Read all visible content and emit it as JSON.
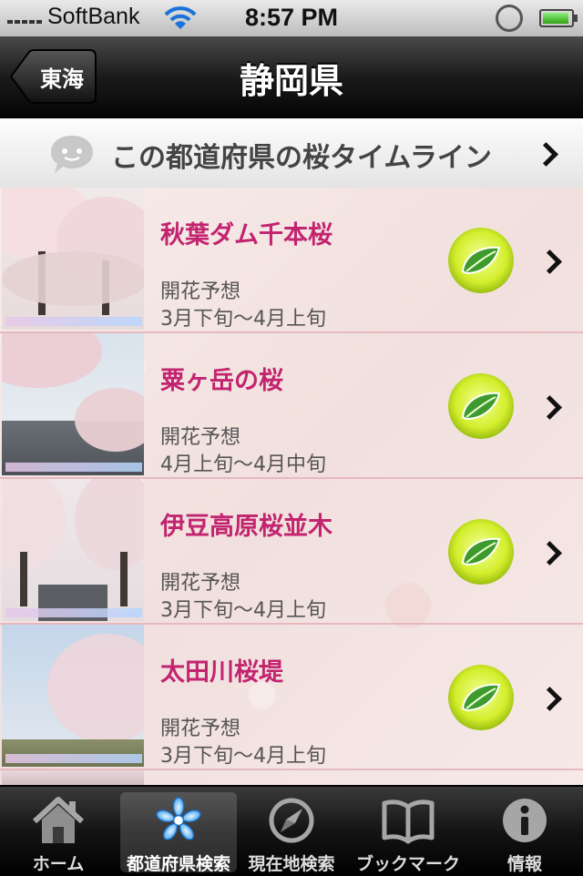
{
  "status": {
    "carrier": "SoftBank",
    "time": "8:57 PM"
  },
  "nav": {
    "back_label": "東海",
    "title": "静岡県"
  },
  "timeline": {
    "label": "この都道府県の桜タイムライン",
    "icon": "speech-bubble-icon"
  },
  "forecast_label": "開花予想",
  "spots": [
    {
      "name": "秋葉ダム千本桜",
      "forecast_label": "開花予想",
      "forecast": "3月下旬〜4月上旬"
    },
    {
      "name": "粟ヶ岳の桜",
      "forecast_label": "開花予想",
      "forecast": "4月上旬〜4月中旬"
    },
    {
      "name": "伊豆高原桜並木",
      "forecast_label": "開花予想",
      "forecast": "3月下旬〜4月上旬"
    },
    {
      "name": "太田川桜堤",
      "forecast_label": "開花予想",
      "forecast": "3月下旬〜4月上旬"
    }
  ],
  "tabs": [
    {
      "label": "ホーム",
      "icon": "home-icon",
      "selected": false
    },
    {
      "label": "都道府県検索",
      "icon": "sakura-icon",
      "selected": true
    },
    {
      "label": "現在地検索",
      "icon": "compass-icon",
      "selected": false
    },
    {
      "label": "ブックマーク",
      "icon": "book-icon",
      "selected": false
    },
    {
      "label": "情報",
      "icon": "info-icon",
      "selected": false
    }
  ],
  "colors": {
    "accent": "#c2246f",
    "leaf_badge": "#d6f23a"
  }
}
